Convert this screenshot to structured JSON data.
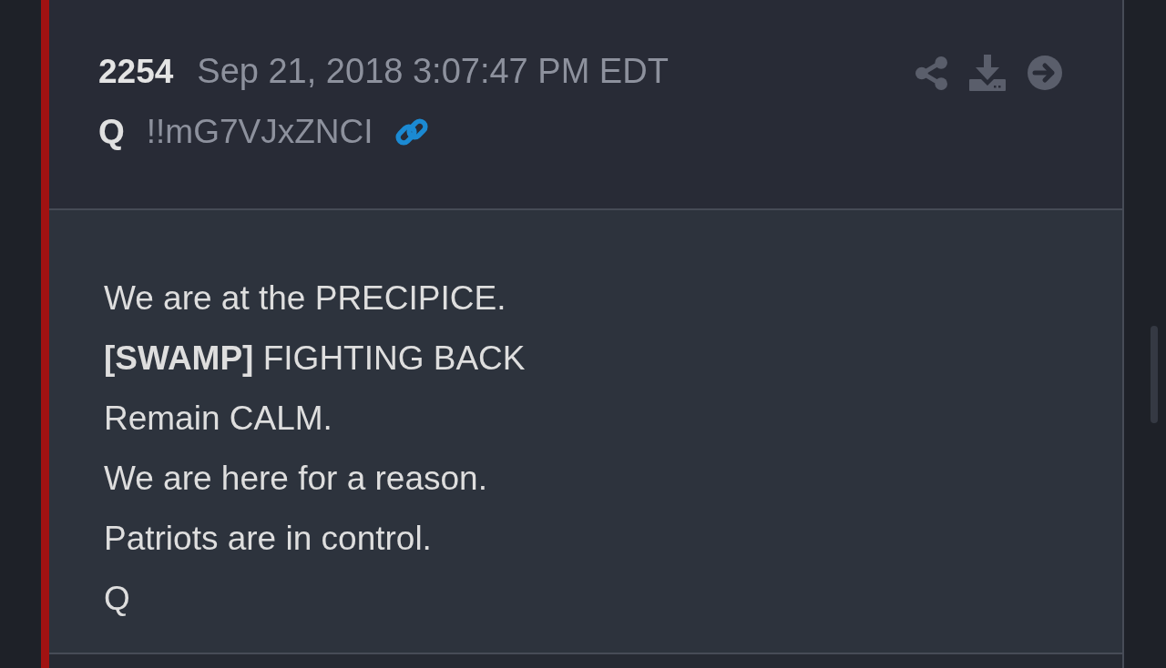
{
  "post": {
    "number": "2254",
    "timestamp": "Sep 21, 2018 3:07:47 PM EDT",
    "author": "Q",
    "tripcode": "!!mG7VJxZNCI",
    "body_lines": [
      "We are at the PRECIPICE.",
      "**[SWAMP]** FIGHTING BACK",
      "Remain CALM.",
      "We are here for a reason.",
      "Patriots are in control.",
      "Q"
    ]
  }
}
